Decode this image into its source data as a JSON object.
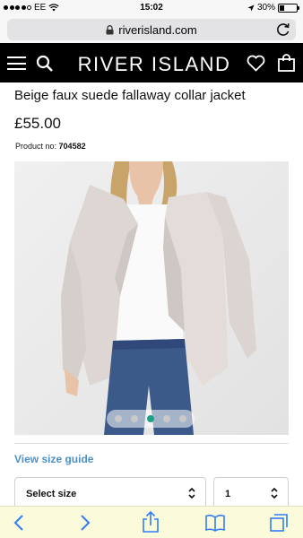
{
  "status_bar": {
    "carrier": "EE",
    "time": "15:02",
    "battery_percent": "30%",
    "battery_level": 0.3
  },
  "browser": {
    "url": "riverisland.com",
    "lock_icon": "lock-icon",
    "reload_icon": "reload-icon"
  },
  "header": {
    "logo_text": "RIVER ISLAND",
    "icons": [
      "menu-icon",
      "search-icon",
      "heart-icon",
      "bag-icon"
    ]
  },
  "product": {
    "title": "Beige faux suede fallaway collar jacket",
    "price": "£55.00",
    "product_no_label": "Product no:",
    "product_no": "704582",
    "carousel": {
      "count": 5,
      "active_index": 2
    }
  },
  "actions": {
    "size_guide": "View size guide",
    "size_select": "Select size",
    "quantity": "1"
  },
  "toolbar": {
    "icons": [
      "back-icon",
      "forward-icon",
      "share-icon",
      "bookmarks-icon",
      "tabs-icon"
    ]
  },
  "colors": {
    "accent_link": "#4a90c8",
    "carousel_active": "#21a089",
    "header_bg": "#000000",
    "toolbar_bg": "#fbfbdc",
    "toolbar_icon": "#2f7ef6"
  }
}
